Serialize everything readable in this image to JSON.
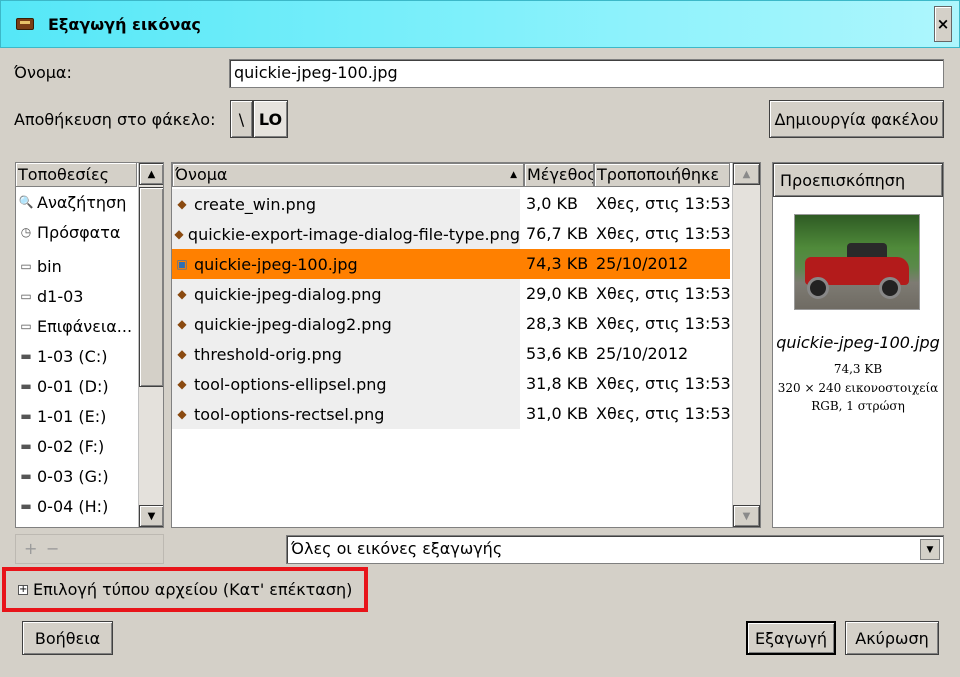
{
  "window": {
    "title": "Εξαγωγή εικόνας",
    "close_glyph": "×"
  },
  "name_field": {
    "label": "Όνομα:",
    "value": "quickie-jpeg-100.jpg"
  },
  "folder": {
    "label": "Αποθήκευση στο φάκελο:",
    "path_buttons": [
      "\\",
      "LO"
    ],
    "create_folder_label": "Δημιουργία φακέλου"
  },
  "places": {
    "header": "Τοποθεσίες",
    "items": [
      {
        "label": "Αναζήτηση",
        "icon": "search-icon"
      },
      {
        "label": "Πρόσφατα",
        "icon": "recent-icon"
      },
      {
        "label": "bin",
        "icon": "folder-icon"
      },
      {
        "label": "d1-03",
        "icon": "folder-icon"
      },
      {
        "label": "Επιφάνεια...",
        "icon": "folder-icon"
      },
      {
        "label": "1-03 (C:)",
        "icon": "drive-icon"
      },
      {
        "label": "0-01 (D:)",
        "icon": "drive-icon"
      },
      {
        "label": "1-01 (E:)",
        "icon": "drive-icon"
      },
      {
        "label": "0-02 (F:)",
        "icon": "drive-icon"
      },
      {
        "label": "0-03 (G:)",
        "icon": "drive-icon"
      },
      {
        "label": "0-04 (H:)",
        "icon": "drive-icon"
      }
    ],
    "add_glyph": "+",
    "remove_glyph": "−"
  },
  "files": {
    "columns": {
      "name": "Όνομα",
      "size": "Μέγεθος",
      "modified": "Τροποποιήθηκε"
    },
    "rows": [
      {
        "name": "create_win.png",
        "size": "3,0 KB",
        "modified": "Χθες, στις 13:53",
        "type": "png"
      },
      {
        "name": "quickie-export-image-dialog-file-type.png",
        "size": "76,7 KB",
        "modified": "Χθες, στις 13:53",
        "type": "png"
      },
      {
        "name": "quickie-jpeg-100.jpg",
        "size": "74,3 KB",
        "modified": "25/10/2012",
        "type": "jpg",
        "selected": true
      },
      {
        "name": "quickie-jpeg-dialog.png",
        "size": "29,0 KB",
        "modified": "Χθες, στις 13:53",
        "type": "png"
      },
      {
        "name": "quickie-jpeg-dialog2.png",
        "size": "28,3 KB",
        "modified": "Χθες, στις 13:53",
        "type": "png"
      },
      {
        "name": "threshold-orig.png",
        "size": "53,6 KB",
        "modified": "25/10/2012",
        "type": "png"
      },
      {
        "name": "tool-options-ellipsel.png",
        "size": "31,8 KB",
        "modified": "Χθες, στις 13:53",
        "type": "png"
      },
      {
        "name": "tool-options-rectsel.png",
        "size": "31,0 KB",
        "modified": "Χθες, στις 13:53",
        "type": "png"
      }
    ]
  },
  "preview": {
    "header": "Προεπισκόπηση",
    "filename": "quickie-jpeg-100.jpg",
    "size": "74,3 KB",
    "dimensions": "320 × 240 εικονοστοιχεία",
    "mode": "RGB, 1 στρώση"
  },
  "filter": {
    "selected": "Όλες οι εικόνες εξαγωγής"
  },
  "file_type_expander": {
    "label": "Επιλογή τύπου αρχείου (Κατ' επέκταση)",
    "glyph": "+"
  },
  "buttons": {
    "help": "Βοήθεια",
    "export": "Εξαγωγή",
    "cancel": "Ακύρωση"
  },
  "colors": {
    "selection": "#ff8000",
    "titlebar": "#55e7f7",
    "highlight": "#e8141a"
  }
}
